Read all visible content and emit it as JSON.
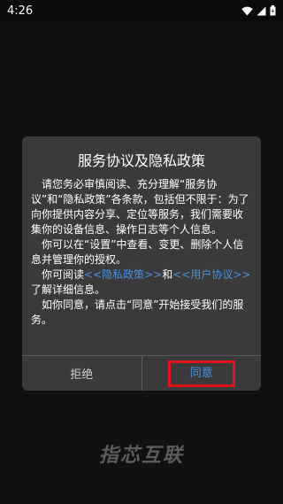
{
  "status_bar": {
    "time": "4:26",
    "icons": [
      "wifi-icon",
      "signal-icon",
      "battery-icon"
    ]
  },
  "dialog": {
    "title": "服务协议及隐私政策",
    "paragraph1": "请您务必审慎阅读、充分理解“服务协议”和“隐私政策”各条款，包括但不限于：为了向你提供内容分享、定位等服务，我们需要收集你的设备信息、操作日志等个人信息。",
    "paragraph2": "你可以在“设置”中查看、变更、删除个人信息并管理你的授权。",
    "paragraph3_prefix": "你可阅读",
    "privacy_link": "<<隐私政策>>",
    "paragraph3_and": "和",
    "user_agreement_link": "<<用户协议>>",
    "paragraph3_suffix": "了解详细信息。",
    "paragraph4": "如你同意，请点击“同意”开始接受我们的服务。",
    "reject_label": "拒绝",
    "agree_label": "同意"
  },
  "watermark": "指芯互联",
  "colors": {
    "background": "#111111",
    "dialog_bg": "#3a3a3a",
    "link": "#4a90e2",
    "highlight": "#e0121b"
  }
}
